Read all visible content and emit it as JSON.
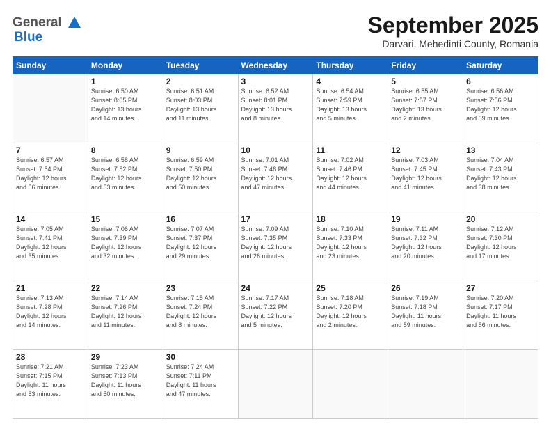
{
  "header": {
    "logo_general": "General",
    "logo_blue": "Blue",
    "month_title": "September 2025",
    "location": "Darvari, Mehedinti County, Romania"
  },
  "weekdays": [
    "Sunday",
    "Monday",
    "Tuesday",
    "Wednesday",
    "Thursday",
    "Friday",
    "Saturday"
  ],
  "weeks": [
    [
      {
        "day": "",
        "info": ""
      },
      {
        "day": "1",
        "info": "Sunrise: 6:50 AM\nSunset: 8:05 PM\nDaylight: 13 hours\nand 14 minutes."
      },
      {
        "day": "2",
        "info": "Sunrise: 6:51 AM\nSunset: 8:03 PM\nDaylight: 13 hours\nand 11 minutes."
      },
      {
        "day": "3",
        "info": "Sunrise: 6:52 AM\nSunset: 8:01 PM\nDaylight: 13 hours\nand 8 minutes."
      },
      {
        "day": "4",
        "info": "Sunrise: 6:54 AM\nSunset: 7:59 PM\nDaylight: 13 hours\nand 5 minutes."
      },
      {
        "day": "5",
        "info": "Sunrise: 6:55 AM\nSunset: 7:57 PM\nDaylight: 13 hours\nand 2 minutes."
      },
      {
        "day": "6",
        "info": "Sunrise: 6:56 AM\nSunset: 7:56 PM\nDaylight: 12 hours\nand 59 minutes."
      }
    ],
    [
      {
        "day": "7",
        "info": "Sunrise: 6:57 AM\nSunset: 7:54 PM\nDaylight: 12 hours\nand 56 minutes."
      },
      {
        "day": "8",
        "info": "Sunrise: 6:58 AM\nSunset: 7:52 PM\nDaylight: 12 hours\nand 53 minutes."
      },
      {
        "day": "9",
        "info": "Sunrise: 6:59 AM\nSunset: 7:50 PM\nDaylight: 12 hours\nand 50 minutes."
      },
      {
        "day": "10",
        "info": "Sunrise: 7:01 AM\nSunset: 7:48 PM\nDaylight: 12 hours\nand 47 minutes."
      },
      {
        "day": "11",
        "info": "Sunrise: 7:02 AM\nSunset: 7:46 PM\nDaylight: 12 hours\nand 44 minutes."
      },
      {
        "day": "12",
        "info": "Sunrise: 7:03 AM\nSunset: 7:45 PM\nDaylight: 12 hours\nand 41 minutes."
      },
      {
        "day": "13",
        "info": "Sunrise: 7:04 AM\nSunset: 7:43 PM\nDaylight: 12 hours\nand 38 minutes."
      }
    ],
    [
      {
        "day": "14",
        "info": "Sunrise: 7:05 AM\nSunset: 7:41 PM\nDaylight: 12 hours\nand 35 minutes."
      },
      {
        "day": "15",
        "info": "Sunrise: 7:06 AM\nSunset: 7:39 PM\nDaylight: 12 hours\nand 32 minutes."
      },
      {
        "day": "16",
        "info": "Sunrise: 7:07 AM\nSunset: 7:37 PM\nDaylight: 12 hours\nand 29 minutes."
      },
      {
        "day": "17",
        "info": "Sunrise: 7:09 AM\nSunset: 7:35 PM\nDaylight: 12 hours\nand 26 minutes."
      },
      {
        "day": "18",
        "info": "Sunrise: 7:10 AM\nSunset: 7:33 PM\nDaylight: 12 hours\nand 23 minutes."
      },
      {
        "day": "19",
        "info": "Sunrise: 7:11 AM\nSunset: 7:32 PM\nDaylight: 12 hours\nand 20 minutes."
      },
      {
        "day": "20",
        "info": "Sunrise: 7:12 AM\nSunset: 7:30 PM\nDaylight: 12 hours\nand 17 minutes."
      }
    ],
    [
      {
        "day": "21",
        "info": "Sunrise: 7:13 AM\nSunset: 7:28 PM\nDaylight: 12 hours\nand 14 minutes."
      },
      {
        "day": "22",
        "info": "Sunrise: 7:14 AM\nSunset: 7:26 PM\nDaylight: 12 hours\nand 11 minutes."
      },
      {
        "day": "23",
        "info": "Sunrise: 7:15 AM\nSunset: 7:24 PM\nDaylight: 12 hours\nand 8 minutes."
      },
      {
        "day": "24",
        "info": "Sunrise: 7:17 AM\nSunset: 7:22 PM\nDaylight: 12 hours\nand 5 minutes."
      },
      {
        "day": "25",
        "info": "Sunrise: 7:18 AM\nSunset: 7:20 PM\nDaylight: 12 hours\nand 2 minutes."
      },
      {
        "day": "26",
        "info": "Sunrise: 7:19 AM\nSunset: 7:18 PM\nDaylight: 11 hours\nand 59 minutes."
      },
      {
        "day": "27",
        "info": "Sunrise: 7:20 AM\nSunset: 7:17 PM\nDaylight: 11 hours\nand 56 minutes."
      }
    ],
    [
      {
        "day": "28",
        "info": "Sunrise: 7:21 AM\nSunset: 7:15 PM\nDaylight: 11 hours\nand 53 minutes."
      },
      {
        "day": "29",
        "info": "Sunrise: 7:23 AM\nSunset: 7:13 PM\nDaylight: 11 hours\nand 50 minutes."
      },
      {
        "day": "30",
        "info": "Sunrise: 7:24 AM\nSunset: 7:11 PM\nDaylight: 11 hours\nand 47 minutes."
      },
      {
        "day": "",
        "info": ""
      },
      {
        "day": "",
        "info": ""
      },
      {
        "day": "",
        "info": ""
      },
      {
        "day": "",
        "info": ""
      }
    ]
  ]
}
